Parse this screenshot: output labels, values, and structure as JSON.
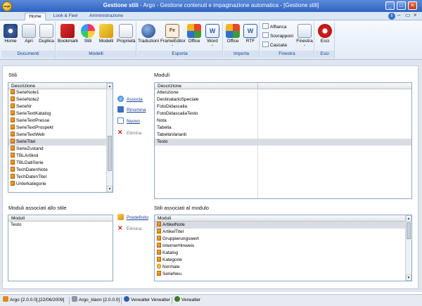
{
  "window": {
    "title_bold": "Gestione stili",
    "title_rest": " - Argo - Gestione contenuti e impaginazione automatica - [Gestione stili]",
    "logo_text": "argo",
    "buttons": {
      "minimize": "_",
      "maximize": "□",
      "close": "×"
    }
  },
  "ribbon": {
    "tabs": [
      "Home",
      "Look & Feel",
      "Amministrazione"
    ],
    "help_label": "i",
    "groups": {
      "documenti": {
        "label": "Documenti",
        "buttons": [
          "Home",
          "Apri",
          "Duplica"
        ]
      },
      "modelli": {
        "label": "Modelli",
        "buttons": [
          "Bookmark",
          "Stili",
          "Modelli",
          "Proprietà"
        ]
      },
      "esporta": {
        "label": "Esporta",
        "buttons": [
          "Traduzioni",
          "FrameEditor",
          "Office",
          "Word"
        ]
      },
      "importa": {
        "label": "Importa",
        "buttons": [
          "Office",
          "RTF"
        ]
      },
      "finestra": {
        "label": "Finestra",
        "small_buttons": [
          "Affianca",
          "Sovrapponi",
          "Cascata"
        ],
        "button": "Finestra"
      },
      "esci": {
        "label": "Esci",
        "buttons": [
          "Esci"
        ]
      }
    },
    "dropdown_mark": "⌄"
  },
  "stili": {
    "label": "Stili",
    "column": "Descrizione",
    "rows": [
      "SerieNote1",
      "SerieNote2",
      "SerieNr",
      "SerieTextKatalog",
      "SerieTextPresse",
      "SerieTextProspekt",
      "SerieTextWeb",
      "SerieTitel",
      "SerieZustand",
      "TBLArtikoli",
      "TBLDatiSerie",
      "TechDatenNote",
      "TechDatenTitel",
      "Unterkategorie"
    ],
    "selected_index": 7
  },
  "actions_top": {
    "associa": "Associa",
    "rinomina": "Rinomina",
    "nuovo": "Nuovo",
    "elimina": "Elimina"
  },
  "moduli": {
    "label": "Moduli",
    "column": "Descrizione",
    "rows": [
      "Attenzione",
      "DestinatarioSpeciale",
      "FotoDidascalia",
      "FotoDidascaliaTesto",
      "Nota",
      "Tabella",
      "TabellaVarianti",
      "Testo"
    ],
    "selected_index": 7
  },
  "moduli_associati": {
    "label": "Moduli associati allo stile",
    "column": "Moduli",
    "rows": [
      "Testo"
    ]
  },
  "actions_bottom": {
    "predefinito": "Predefinito",
    "elimina": "Elimina"
  },
  "stili_associati": {
    "label": "Stili associati al modulo",
    "column": "Moduli",
    "rows": [
      "ArtikelNote",
      "ArtikelTitel",
      "Gruppierungswert",
      "InternerHinweis",
      "Katalog",
      "Kategorie",
      "Normale",
      "SerieNeu"
    ],
    "selected_index": 0,
    "normal_index": 6
  },
  "statusbar": {
    "app": "Argo",
    "version": "[2.0.0.0],[22/06/2009]",
    "db": "Argo_klann [2.0.0.0]",
    "user": "Verwalter Verwalter",
    "role": "Verwalter"
  },
  "colors": {
    "title_bar": "#2f63c2",
    "ribbon_group_label": "#15428b",
    "link": "#1a3d9c",
    "delete_icon": "#cc2020"
  }
}
